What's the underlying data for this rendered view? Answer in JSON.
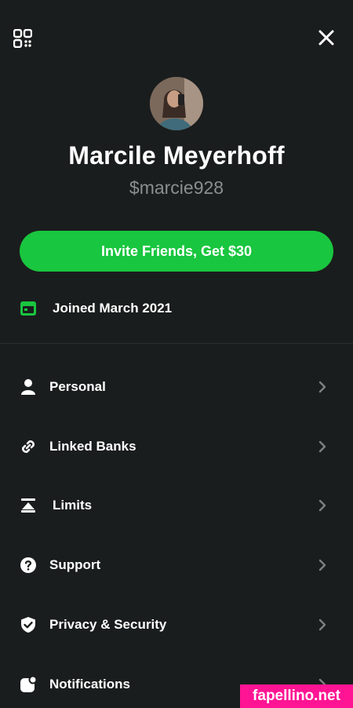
{
  "colors": {
    "background": "#1a1d1d",
    "accent_green": "#19c63f",
    "muted_text": "#8b8f8f",
    "chevron": "#7d8181",
    "watermark_bg": "#ff1493"
  },
  "header": {
    "qr_icon": "qr-code-icon",
    "close_icon": "close-icon"
  },
  "profile": {
    "name": "Marcile Meyerhoff",
    "cashtag": "$marcie928",
    "avatar_icon": "avatar"
  },
  "invite": {
    "label": "Invite Friends, Get $30"
  },
  "joined": {
    "icon": "calendar-icon",
    "text": "Joined March 2021"
  },
  "menu": {
    "items": [
      {
        "label": "Personal",
        "icon": "person-icon"
      },
      {
        "label": "Linked Banks",
        "icon": "link-icon"
      },
      {
        "label": "Limits",
        "icon": "limits-icon"
      },
      {
        "label": "Support",
        "icon": "help-icon"
      },
      {
        "label": "Privacy & Security",
        "icon": "shield-icon"
      },
      {
        "label": "Notifications",
        "icon": "notification-icon"
      }
    ]
  },
  "watermark": {
    "text": "fapellino.net"
  }
}
